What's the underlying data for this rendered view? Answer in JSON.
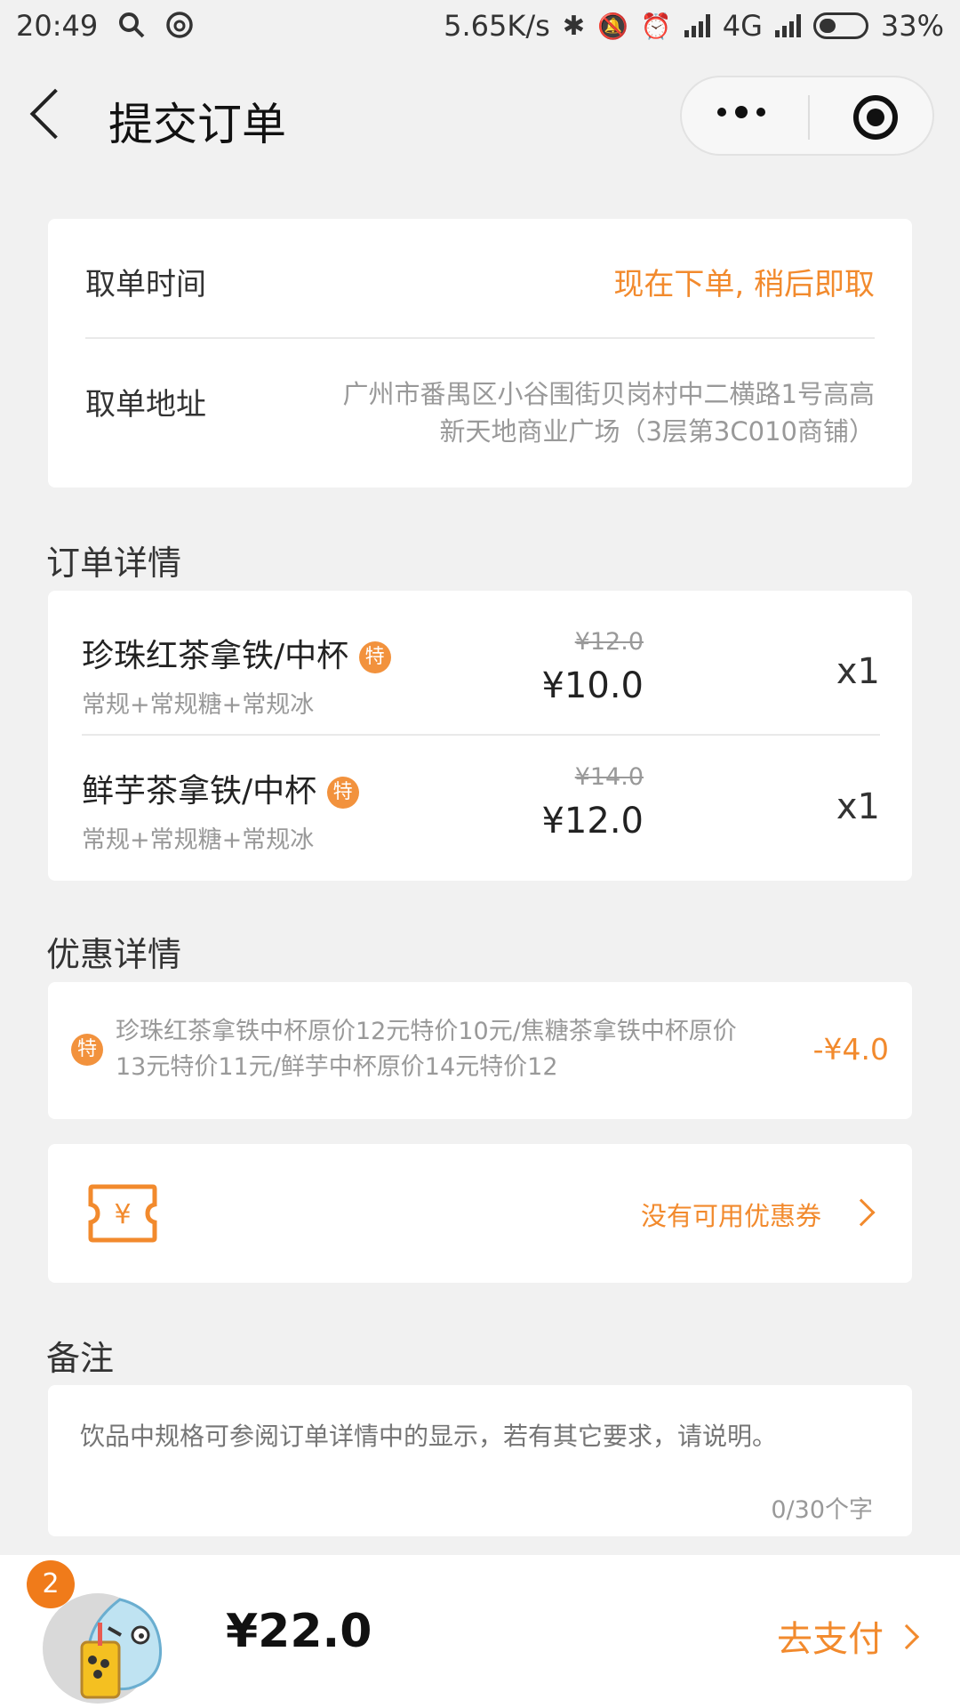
{
  "status_bar": {
    "time": "20:49",
    "network_speed": "5.65K/s",
    "network_type": "4G",
    "battery": "33%"
  },
  "nav": {
    "title": "提交订单"
  },
  "pickup": {
    "time_label": "取单时间",
    "time_value": "现在下单, 稍后即取",
    "address_label": "取单地址",
    "address_line1": "广州市番禺区小谷围街贝岗村中二横路1号高高",
    "address_line2": "新天地商业广场（3层第3C010商铺）"
  },
  "order_details": {
    "title": "订单详情",
    "badge": "特",
    "items": [
      {
        "name": "珍珠红茶拿铁/中杯",
        "spec": "常规+常规糖+常规冰",
        "original_price": "¥12.0",
        "price": "¥10.0",
        "qty": "x1"
      },
      {
        "name": "鲜芋茶拿铁/中杯",
        "spec": "常规+常规糖+常规冰",
        "original_price": "¥14.0",
        "price": "¥12.0",
        "qty": "x1"
      }
    ]
  },
  "discount": {
    "title": "优惠详情",
    "badge": "特",
    "text_line1": "珍珠红茶拿铁中杯原价12元特价10元/焦糖茶拿铁中杯原价",
    "text_line2": "13元特价11元/鲜芋中杯原价14元特价12",
    "amount": "-¥4.0"
  },
  "coupon": {
    "icon_symbol": "¥",
    "label": "没有可用优惠券"
  },
  "remark": {
    "title": "备注",
    "placeholder": "饮品中规格可参阅订单详情中的显示，若有其它要求，请说明。",
    "counter": "0/30个字"
  },
  "footer": {
    "cart_count": "2",
    "total": "¥22.0",
    "pay_label": "去支付"
  },
  "colors": {
    "accent": "#f28a2d",
    "background": "#f1f1f1"
  }
}
